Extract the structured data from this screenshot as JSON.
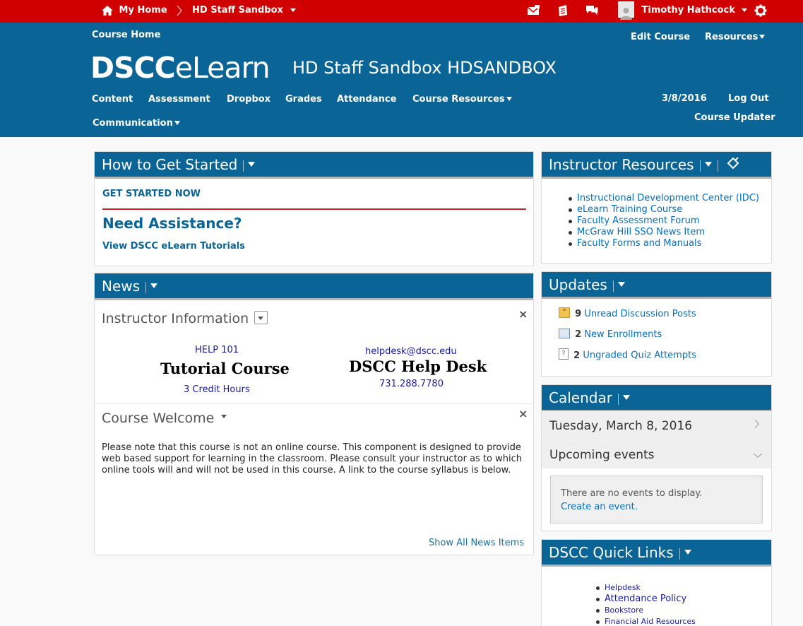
{
  "topbar": {
    "home": "My Home",
    "course": "HD Staff Sandbox",
    "user": "Timothy Hathcock"
  },
  "header": {
    "course_home": "Course Home",
    "edit_course": "Edit Course",
    "resources": "Resources",
    "logo_bold": "DSCC",
    "logo_rest": "eLearn",
    "course_title": "HD Staff Sandbox HDSANDBOX",
    "nav": [
      "Content",
      "Assessment",
      "Dropbox",
      "Grades",
      "Attendance",
      "Course Resources",
      "Communication"
    ],
    "date": "3/8/2016",
    "logout": "Log Out",
    "updater": "Course Updater"
  },
  "started": {
    "title": "How to Get Started",
    "get_started": "GET STARTED NOW",
    "assistance": "Need Assistance?",
    "tutorials": "View DSCC eLearn Tutorials"
  },
  "news": {
    "title": "News",
    "instructor_info": "Instructor Information",
    "help_code": "HELP 101",
    "tutorial_course": "Tutorial Course",
    "credit_hours": "3 Credit Hours",
    "email": "helpdesk@dscc.edu",
    "help_desk": "DSCC Help Desk",
    "phone": "731.288.7780",
    "welcome_title": "Course Welcome",
    "welcome_text": "Please note that this course is not an online course.  This component is designed to provide web based support for learning in the classroom.   Please consult your instructor as to which online tools will and will not be used in this course.  A link to the course syllabus is below.",
    "show_all": "Show All News Items"
  },
  "instructor_resources": {
    "title": "Instructor Resources",
    "links": [
      "Instructional Development Center (IDC)",
      "eLearn Training Course",
      "Faculty Assessment Forum",
      "McGraw Hill SSO News Item",
      "Faculty Forms and Manuals"
    ]
  },
  "updates": {
    "title": "Updates",
    "items": [
      {
        "count": "9",
        "label": "Unread Discussion Posts"
      },
      {
        "count": "2",
        "label": "New Enrollments"
      },
      {
        "count": "2",
        "label": "Ungraded Quiz Attempts"
      }
    ]
  },
  "calendar": {
    "title": "Calendar",
    "date": "Tuesday, March 8, 2016",
    "upcoming": "Upcoming events",
    "no_events": "There are no events to display.",
    "create": "Create an event."
  },
  "quick_links": {
    "title": "DSCC Quick Links",
    "links": [
      "Helpdesk",
      "Attendance Policy",
      "Bookstore",
      "Financial Aid Resources"
    ]
  }
}
